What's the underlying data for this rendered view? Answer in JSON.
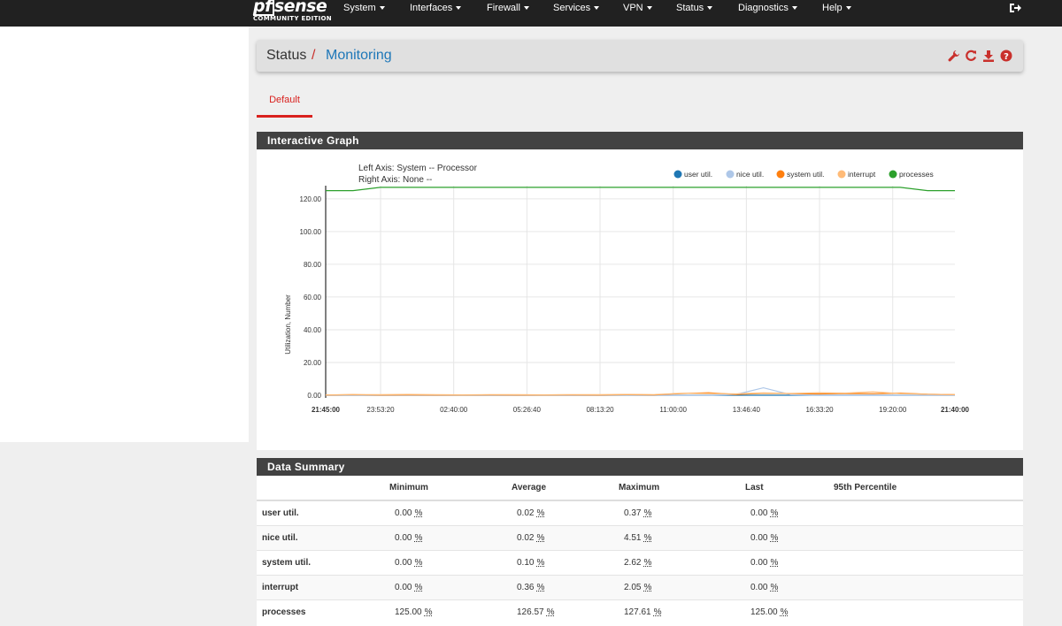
{
  "nav": {
    "brand_logo": "pfsense",
    "brand_pf": "pf",
    "brand_sense": "sense",
    "brand_sub": "COMMUNITY EDITION",
    "items": [
      {
        "label": "System"
      },
      {
        "label": "Interfaces"
      },
      {
        "label": "Firewall"
      },
      {
        "label": "Services"
      },
      {
        "label": "VPN"
      },
      {
        "label": "Status"
      },
      {
        "label": "Diagnostics"
      },
      {
        "label": "Help"
      }
    ],
    "logout_icon": "sign-out-icon"
  },
  "breadcrumb": {
    "parent": "Status",
    "separator": "/",
    "current": "Monitoring",
    "icons": [
      "wrench-icon",
      "refresh-icon",
      "download-icon",
      "help-icon"
    ],
    "icon_color": "#c9302c"
  },
  "tabs": [
    {
      "label": "Default",
      "active": true
    }
  ],
  "graph_panel": {
    "title": "Interactive Graph"
  },
  "chart_data": {
    "type": "line",
    "left_axis_label": "Left Axis: System -- Processor",
    "right_axis_label": "Right Axis: None --",
    "ylabel": "Utilization, Number",
    "ylim": [
      0,
      128
    ],
    "yticks": [
      "0.00",
      "20.00",
      "40.00",
      "60.00",
      "80.00",
      "100.00",
      "120.00"
    ],
    "x_start_label": "21:45:00",
    "x_end_label": "21:40:00",
    "xticks": [
      "23:53:20",
      "02:40:00",
      "05:26:40",
      "08:13:20",
      "11:00:00",
      "13:46:40",
      "16:33:20",
      "19:20:00"
    ],
    "legend_position": "top-right",
    "series": [
      {
        "name": "user util.",
        "color": "#1f77b4",
        "values": [
          0,
          0,
          0,
          0,
          0,
          0,
          0,
          0,
          0,
          0,
          0,
          0,
          0,
          0,
          0,
          0,
          0,
          0,
          0,
          0,
          0,
          0,
          0,
          0
        ]
      },
      {
        "name": "nice util.",
        "color": "#aec7e8",
        "values": [
          0,
          0,
          0,
          0,
          0,
          0,
          0,
          0,
          0,
          0,
          0,
          0,
          0,
          0,
          0,
          0.5,
          4.51,
          0.3,
          0,
          0,
          0,
          0,
          0,
          0
        ]
      },
      {
        "name": "system util.",
        "color": "#ff7f0e",
        "values": [
          0.1,
          0.3,
          0.1,
          0.2,
          0.1,
          0.1,
          0.2,
          0.1,
          0.1,
          0.2,
          0.1,
          0.3,
          0.2,
          1.0,
          1.5,
          0.5,
          1.2,
          1.0,
          0.8,
          1.1,
          0.9,
          1.3,
          0.6,
          0.4
        ]
      },
      {
        "name": "interrupt",
        "color": "#ffbb78",
        "values": [
          0.2,
          0.4,
          0.3,
          0.5,
          0.3,
          0.2,
          0.4,
          0.3,
          0.2,
          0.4,
          0.3,
          0.5,
          0.4,
          1.2,
          1.0,
          0.8,
          1.4,
          1.1,
          1.5,
          1.3,
          2.05,
          1.0,
          0.6,
          0.4
        ]
      },
      {
        "name": "processes",
        "color": "#2ca02c",
        "values": [
          125,
          125,
          127,
          127,
          127,
          127,
          127,
          127,
          127,
          127,
          127,
          127,
          127,
          127,
          127,
          127,
          127,
          127,
          127,
          127,
          127,
          127,
          125,
          125
        ]
      }
    ]
  },
  "summary": {
    "title": "Data Summary",
    "columns": [
      "",
      "Minimum",
      "Average",
      "Maximum",
      "Last",
      "95th Percentile"
    ],
    "unit": "%",
    "rows": [
      {
        "name": "user util.",
        "min": "0.00",
        "avg": "0.02",
        "max": "0.37",
        "last": "0.00",
        "p95": ""
      },
      {
        "name": "nice util.",
        "min": "0.00",
        "avg": "0.02",
        "max": "4.51",
        "last": "0.00",
        "p95": ""
      },
      {
        "name": "system util.",
        "min": "0.00",
        "avg": "0.10",
        "max": "2.62",
        "last": "0.00",
        "p95": ""
      },
      {
        "name": "interrupt",
        "min": "0.00",
        "avg": "0.36",
        "max": "2.05",
        "last": "0.00",
        "p95": ""
      },
      {
        "name": "processes",
        "min": "125.00",
        "avg": "126.57",
        "max": "127.61",
        "last": "125.00",
        "p95": ""
      }
    ]
  }
}
